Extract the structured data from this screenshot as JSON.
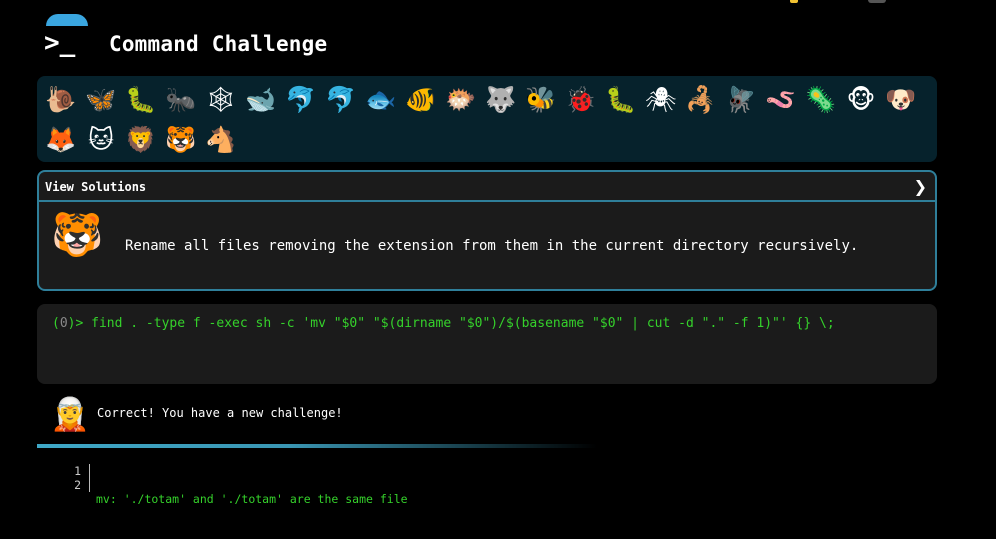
{
  "app": {
    "title": "Command Challenge",
    "prompt_glyph": ">_"
  },
  "colors": {
    "accent": "#3aa6e0",
    "panel": "#06222c",
    "border": "#2f7f9a",
    "command": "#35d12b"
  },
  "animals": [
    "🐌",
    "🦋",
    "🐛",
    "🐜",
    "🕸",
    "🐋",
    "🐬",
    "🐬",
    "🐟",
    "🐠",
    "🐡",
    "🐺",
    "🐝",
    "🐞",
    "🐛",
    "🕷",
    "🦂",
    "🪰",
    "🪱",
    "🦠",
    "🐵",
    "🐶",
    "🦊",
    "🐱",
    "🦁",
    "🐯",
    "🐴"
  ],
  "solutions": {
    "label": "View Solutions",
    "chevron": "❯",
    "avatar": "🐯",
    "challenge_text": "Rename all files removing the extension from them in the current directory recursively."
  },
  "terminal": {
    "prompt_open": "(",
    "prompt_zero": "0",
    "prompt_close": ")> ",
    "command": "find . -type f -exec sh -c 'mv \"$0\" \"$(dirname \"$0\")/$(basename \"$0\" | cut -d \".\" -f 1)\"' {} \\;"
  },
  "feedback": {
    "avatar": "🧝",
    "message": "Correct! You have a new challenge!"
  },
  "output": {
    "line_numbers": [
      "1",
      "2"
    ],
    "lines": [
      "mv: './totam' and './totam' are the same file",
      ""
    ]
  }
}
